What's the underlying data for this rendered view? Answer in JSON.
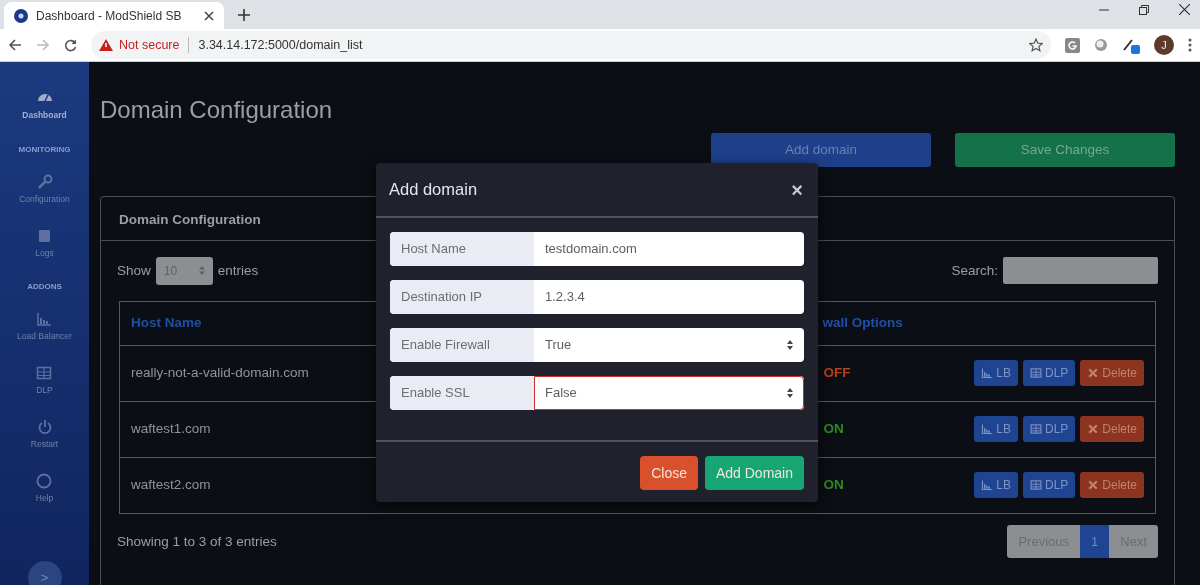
{
  "browser": {
    "tab_title": "Dashboard - ModShield SB",
    "security": "Not secure",
    "url": "3.34.14.172:5000/domain_list",
    "avatar": "J"
  },
  "sidebar": {
    "items": [
      {
        "kind": "link",
        "label": "Dashboard",
        "selected": true
      },
      {
        "kind": "heading",
        "label": "MONITORING"
      },
      {
        "kind": "link",
        "label": "Configuration",
        "selected": false
      },
      {
        "kind": "link",
        "label": "Logs",
        "selected": false
      },
      {
        "kind": "heading",
        "label": "ADDONS"
      },
      {
        "kind": "link",
        "label": "Load Balancer",
        "selected": false
      },
      {
        "kind": "link",
        "label": "DLP",
        "selected": false
      },
      {
        "kind": "link",
        "label": "Restart",
        "selected": false
      },
      {
        "kind": "link",
        "label": "Help",
        "selected": false
      }
    ],
    "toggle": ">"
  },
  "page": {
    "title": "Domain Configuration",
    "buttons": [
      {
        "label": "Add domain",
        "kind": "primary"
      },
      {
        "label": "Save Changes",
        "kind": "success"
      }
    ]
  },
  "card": {
    "title": "Domain Configuration",
    "show": "Show",
    "page_size": "10",
    "entries": "entries",
    "search_label": "Search:",
    "columns": [
      "Host Name",
      "",
      "",
      "wall Options"
    ],
    "rows": [
      {
        "host": "really-not-a-valid-domain.com",
        "status": "OFF",
        "on": false,
        "actions": [
          "LB",
          "DLP",
          "Delete"
        ]
      },
      {
        "host": "waftest1.com",
        "status": "ON",
        "on": true,
        "actions": [
          "LB",
          "DLP",
          "Delete"
        ]
      },
      {
        "host": "waftest2.com",
        "status": "ON",
        "on": true,
        "actions": [
          "LB",
          "DLP",
          "Delete"
        ]
      }
    ],
    "info": "Showing 1 to 3 of 3 entries",
    "pagination": [
      {
        "label": "Previous",
        "selected": false
      },
      {
        "label": "1",
        "selected": true
      },
      {
        "label": "Next",
        "selected": false
      }
    ]
  },
  "modal": {
    "title": "Add domain",
    "close_icon": "×",
    "fields": [
      {
        "kind": "text",
        "label": "Host Name",
        "value": "testdomain.com",
        "invalid": false
      },
      {
        "kind": "text",
        "label": "Destination IP",
        "value": "1.2.3.4",
        "invalid": false
      },
      {
        "kind": "select",
        "label": "Enable Firewall",
        "value": "True",
        "invalid": false
      },
      {
        "kind": "select",
        "label": "Enable SSL",
        "value": "False",
        "invalid": true
      }
    ],
    "buttons": [
      {
        "label": "Close",
        "kind": "danger"
      },
      {
        "label": "Add Domain",
        "kind": "success"
      }
    ]
  }
}
